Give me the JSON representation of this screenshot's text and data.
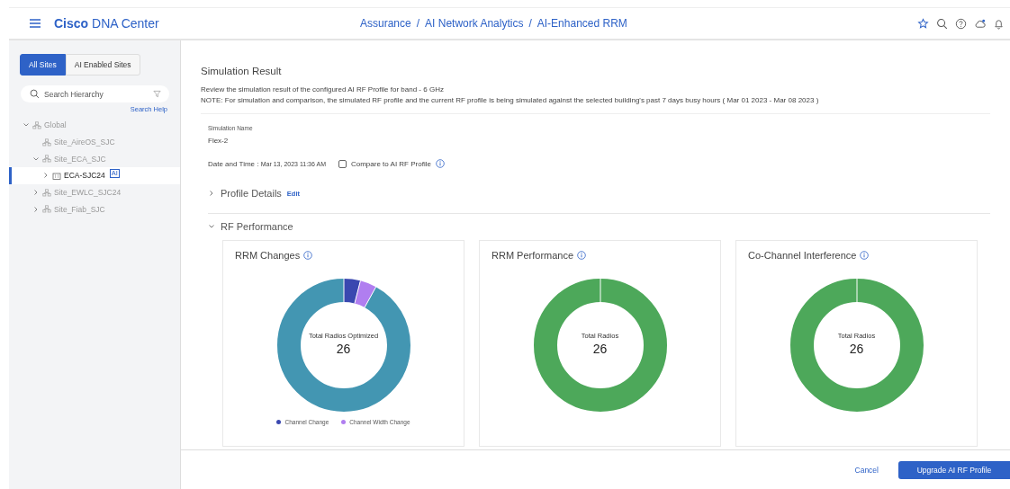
{
  "header": {
    "brand_bold": "Cisco",
    "brand": "DNA Center",
    "breadcrumb": [
      "Assurance",
      "AI Network Analytics",
      "AI-Enhanced RRM"
    ],
    "separator": "/"
  },
  "sidebar": {
    "tabs": [
      {
        "label": "All Sites",
        "selected": true
      },
      {
        "label": "AI Enabled Sites",
        "selected": false
      }
    ],
    "search": {
      "placeholder": "Search Hierarchy"
    },
    "search_help": "Search Help",
    "tree": [
      {
        "label": "Global",
        "kind": "site",
        "expanded": true,
        "selected": false,
        "children": [
          {
            "label": "Site_AireOS_SJC",
            "kind": "site",
            "selected": false
          },
          {
            "label": "Site_ECA_SJC",
            "kind": "site",
            "expanded": true,
            "selected": false,
            "children": [
              {
                "label": "ECA-SJC24",
                "kind": "building",
                "expanded": false,
                "selected": true,
                "badge": "AI"
              }
            ]
          },
          {
            "label": "Site_EWLC_SJC24",
            "kind": "site",
            "expanded": false,
            "selected": false
          },
          {
            "label": "Site_Fiab_SJC",
            "kind": "site",
            "expanded": false,
            "selected": false
          }
        ]
      }
    ]
  },
  "main": {
    "title": "Simulation Result",
    "description": [
      "Review the simulation result of the configured AI RF Profile for band - 6 GHz",
      "NOTE: For simulation and comparison, the simulated RF profile and the current RF profile is being simulated against the selected building's past 7 days busy hours ( Mar 01 2023 - Mar 08 2023 )"
    ],
    "simulation_name_label": "Simulation Name",
    "simulation_name": "Flex-2",
    "date_label": "Date and Time :",
    "date_value": "Mar 13, 2023 11:36 AM",
    "compare": {
      "label": "Compare to AI RF Profile",
      "checked": false
    },
    "sections": [
      {
        "title": "Profile Details",
        "expanded": false,
        "link": "Edit"
      },
      {
        "title": "RF Performance",
        "expanded": true
      }
    ],
    "cards": [
      {
        "title": "RRM Changes",
        "center_label": "Total Radios Optimized",
        "center_value": "26",
        "kind": "changes",
        "legend": [
          {
            "label": "Channel Change",
            "color": "#3a48b0"
          },
          {
            "label": "Channel Width Change",
            "color": "#b07ef0"
          }
        ]
      },
      {
        "title": "RRM Performance",
        "center_label": "Total Radios",
        "center_value": "26",
        "kind": "full"
      },
      {
        "title": "Co-Channel Interference",
        "center_label": "Total Radios",
        "center_value": "26",
        "kind": "full"
      }
    ]
  },
  "footer": {
    "buttons": [
      {
        "label": "Cancel",
        "kind": "link"
      },
      {
        "label": "Upgrade AI RF Profile",
        "kind": "primary"
      }
    ]
  }
}
